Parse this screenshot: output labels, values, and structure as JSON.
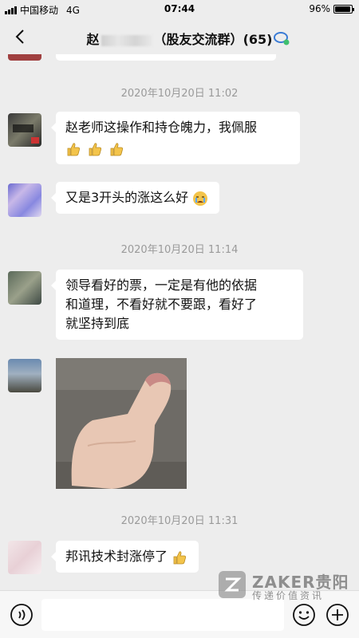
{
  "status_bar": {
    "carrier": "中国移动",
    "network": "4G",
    "time": "07:44",
    "battery": "96%",
    "battery_level": 0.96
  },
  "header": {
    "title_prefix": "赵",
    "title_suffix": "（股友交流群）",
    "member_count": "(65)"
  },
  "messages": [
    {
      "type": "timestamp",
      "text": "2020年10月20日 11:02"
    },
    {
      "type": "text",
      "text": "赵老师这操作和持仓魄力，我佩服",
      "emojis": [
        "thumbs-up",
        "thumbs-up",
        "thumbs-up"
      ]
    },
    {
      "type": "text",
      "text": "又是3开头的涨这么好",
      "emojis": [
        "crying-face"
      ]
    },
    {
      "type": "timestamp",
      "text": "2020年10月20日 11:14"
    },
    {
      "type": "text",
      "lines": [
        "领导看好的票，一定是有他的依据",
        "和道理，不看好就不要跟，看好了",
        "就坚持到底"
      ]
    },
    {
      "type": "image",
      "description": "thumbs-up-photo"
    },
    {
      "type": "timestamp",
      "text": "2020年10月20日 11:31"
    },
    {
      "type": "text",
      "text": "邦讯技术封涨停了",
      "emojis": [
        "thumbs-up"
      ]
    }
  ],
  "watermark": {
    "brand": "ZAKER贵阳",
    "tagline": "传递价值资讯"
  },
  "colors": {
    "background": "#ededed",
    "bubble": "#ffffff",
    "timestamp": "#9a9a9a"
  }
}
